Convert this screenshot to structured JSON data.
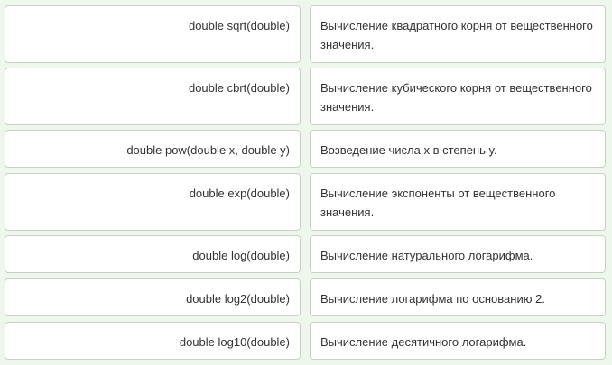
{
  "colors": {
    "background": "#eef7ec",
    "card_background": "#ffffff",
    "card_border": "#c9cfc8",
    "text": "#333333"
  },
  "rows": [
    {
      "function": "double sqrt(double)",
      "description": "Вычисление квадратного корня от вещественного значения."
    },
    {
      "function": "double cbrt(double)",
      "description": "Вычисление кубического корня от вещественного значения."
    },
    {
      "function": "double pow(double x, double y)",
      "description": "Возведение числа x в степень y."
    },
    {
      "function": "double exp(double)",
      "description": "Вычисление экспоненты от вещественного значения."
    },
    {
      "function": "double log(double)",
      "description": "Вычисление натурального логарифма."
    },
    {
      "function": "double log2(double)",
      "description": "Вычисление логарифма по основанию 2."
    },
    {
      "function": "double log10(double)",
      "description": "Вычисление десятичного логарифма."
    }
  ]
}
